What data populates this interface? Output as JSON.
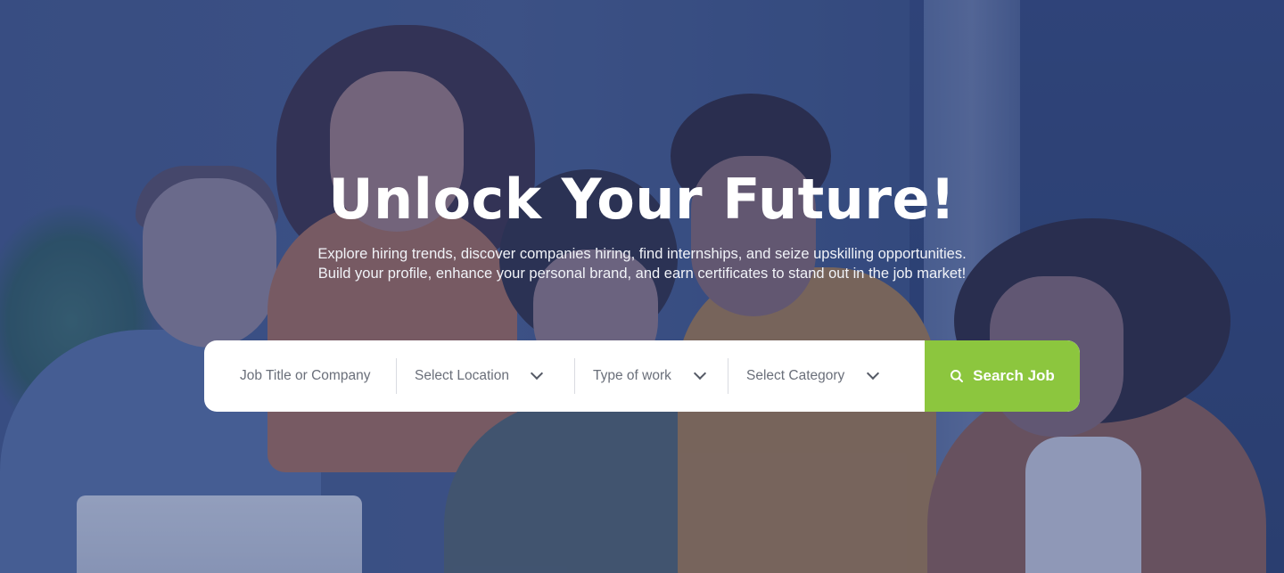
{
  "hero": {
    "title": "Unlock Your Future!",
    "subtitle": "Explore hiring trends, discover companies hiring, find internships, and seize upskilling opportunities. Build your profile, enhance your personal brand, and earn certificates to stand out in the job market!"
  },
  "search": {
    "keyword_placeholder": "Job Title or Company",
    "location_placeholder": "Select Location",
    "work_type_placeholder": "Type of work",
    "category_placeholder": "Select Category",
    "button_label": "Search Job",
    "button_icon": "search-icon"
  },
  "colors": {
    "accent": "#8cc63e",
    "overlay": "#283e78",
    "title": "#ffffff"
  }
}
